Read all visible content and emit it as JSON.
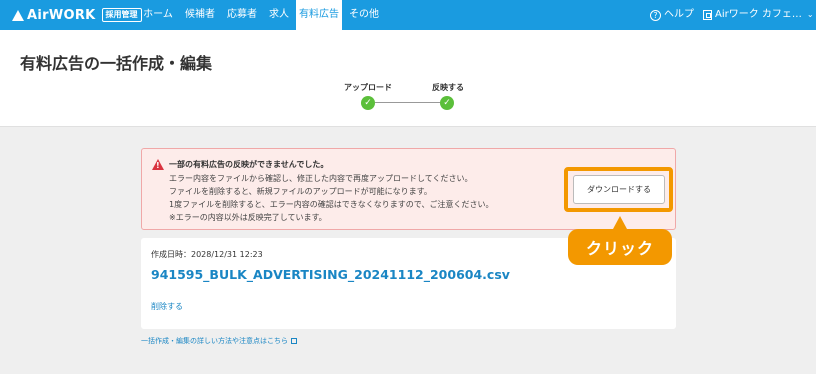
{
  "nav": {
    "logo_text": "AirWORK",
    "logo_badge": "採用管理",
    "tabs": [
      {
        "label": "ホーム"
      },
      {
        "label": "候補者"
      },
      {
        "label": "応募者"
      },
      {
        "label": "求人"
      },
      {
        "label": "有料広告"
      },
      {
        "label": "その他"
      }
    ],
    "help_label": "ヘルプ",
    "account_label": "Airワーク カフェ…"
  },
  "page": {
    "title": "有料広告の一括作成・編集"
  },
  "stepper": {
    "steps": [
      {
        "label": "アップロード"
      },
      {
        "label": "反映する"
      }
    ]
  },
  "alert": {
    "title": "一部の有料広告の反映ができませんでした。",
    "lines": [
      "エラー内容をファイルから確認し、修正した内容で再度アップロードしてください。",
      "ファイルを削除すると、新規ファイルのアップロードが可能になります。",
      "1度ファイルを削除すると、エラー内容の確認はできなくなりますので、ご注意ください。",
      "※エラーの内容以外は反映完了しています。"
    ],
    "download_label": "ダウンロードする"
  },
  "callout": {
    "label": "クリック"
  },
  "file": {
    "created": "作成日時：2028/12/31 12:23",
    "name": "941595_BULK_ADVERTISING_20241112_200604.csv",
    "delete_label": "削除する"
  },
  "footer": {
    "help_link": "一括作成・編集の詳しい方法や注意点はこちら"
  },
  "colors": {
    "brand": "#1a9be0",
    "accent": "#f39800",
    "success": "#5bbf3a",
    "error": "#d9333f"
  }
}
